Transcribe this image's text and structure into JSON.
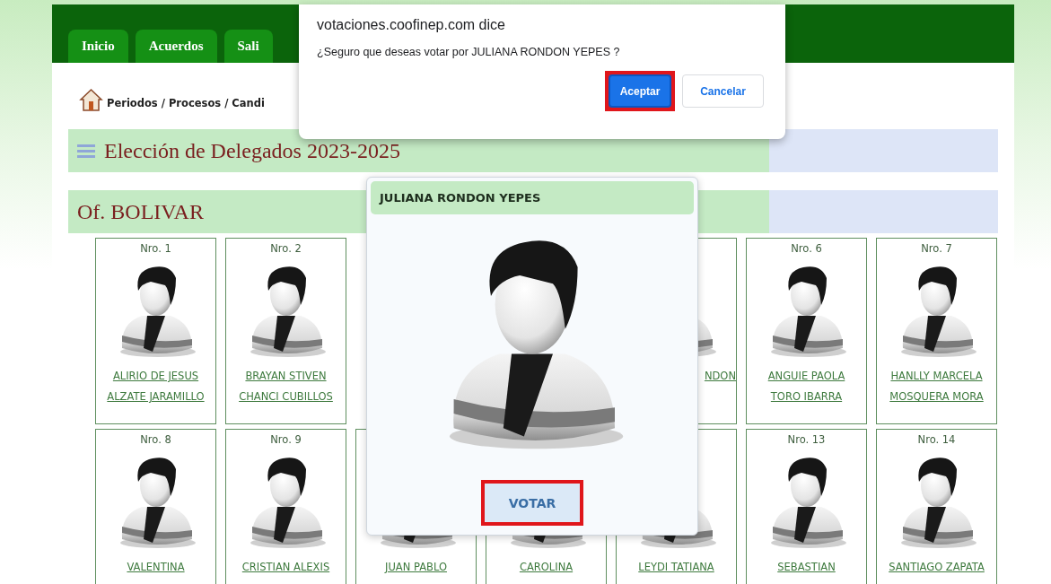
{
  "nav": {
    "tabs": [
      {
        "label": "Inicio"
      },
      {
        "label": "Acuerdos"
      },
      {
        "label": "Sali"
      }
    ]
  },
  "breadcrumb": "Periodos / Procesos / Candi",
  "title": "Elección de Delegados 2023-2025",
  "section": "Of. BOLIVAR",
  "card_rows": [
    [
      {
        "number": "Nro. 1",
        "name_lines": [
          "ALIRIO DE JESUS",
          "ALZATE JARAMILLO"
        ]
      },
      {
        "number": "Nro. 2",
        "name_lines": [
          "BRAYAN STIVEN",
          "CHANCI CUBILLOS"
        ]
      },
      {},
      {},
      {
        "name_lines": [
          "NDON"
        ]
      },
      {
        "number": "Nro. 6",
        "name_lines": [
          "ANGUIE PAOLA",
          "TORO IBARRA"
        ]
      },
      {
        "number": "Nro. 7",
        "name_lines": [
          "HANLLY MARCELA",
          "MOSQUERA MORA"
        ]
      }
    ],
    [
      {
        "number": "Nro. 8",
        "name_lines": [
          "VALENTINA"
        ]
      },
      {
        "number": "Nro. 9",
        "name_lines": [
          "CRISTIAN ALEXIS"
        ]
      },
      {
        "name_lines": [
          "JUAN PABLO"
        ]
      },
      {
        "name_lines": [
          "CAROLINA"
        ]
      },
      {
        "name_lines": [
          "LEYDI TATIANA"
        ]
      },
      {
        "number": "Nro. 13",
        "name_lines": [
          "SEBASTIAN"
        ]
      },
      {
        "number": "Nro. 14",
        "name_lines": [
          "SANTIAGO ZAPATA"
        ]
      }
    ]
  ],
  "candidate_popup": {
    "name": "JULIANA RONDON YEPES",
    "button": {
      "label": "VOTAR",
      "highlighted": true
    }
  },
  "alert": {
    "origin": "votaciones.coofinep.com dice",
    "message": "¿Seguro que deseas votar por JULIANA RONDON YEPES ?",
    "buttons": [
      {
        "label": "Aceptar",
        "kind": "primary",
        "highlighted": true
      },
      {
        "label": "Cancelar",
        "kind": "secondary",
        "highlighted": false
      }
    ]
  }
}
